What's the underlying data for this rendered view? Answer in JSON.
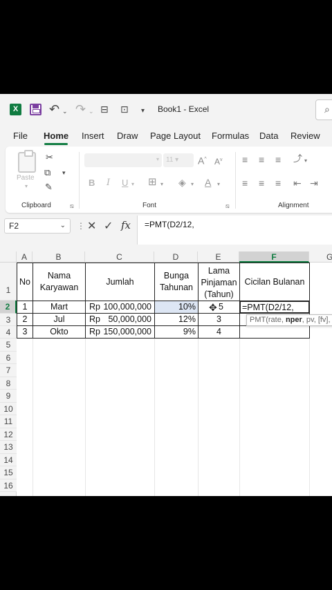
{
  "title_bar": {
    "window_title": "Book1  -  Excel",
    "logo_letter": "X"
  },
  "ribbon_tabs": [
    "File",
    "Home",
    "Insert",
    "Draw",
    "Page Layout",
    "Formulas",
    "Data",
    "Review"
  ],
  "active_tab": "Home",
  "ribbon": {
    "paste_label": "Paste",
    "font_size": "11",
    "groups": {
      "clipboard": "Clipboard",
      "font": "Font",
      "alignment": "Alignment"
    },
    "font_buttons": {
      "bold": "B",
      "italic": "I",
      "underline": "U"
    },
    "grow_font": "A",
    "shrink_font": "A"
  },
  "formula_bar": {
    "name_box": "F2",
    "formula": "=PMT(D2/12,"
  },
  "grid": {
    "columns": [
      "A",
      "B",
      "C",
      "D",
      "E",
      "F",
      "G"
    ],
    "rows": [
      "1",
      "2",
      "3",
      "4",
      "5",
      "6",
      "7",
      "8",
      "9",
      "10",
      "11",
      "12",
      "13",
      "14",
      "15",
      "16"
    ],
    "headers": {
      "no": "No",
      "nama": "Nama Karyawan",
      "jumlah": "Jumlah",
      "bunga": "Bunga Tahunan",
      "lama": "Lama Pinjaman (Tahun)",
      "cicilan": "Cicilan Bulanan"
    },
    "data_rows": [
      {
        "no": "1",
        "nama": "Mart",
        "currency": "Rp",
        "jumlah": "100,000,000",
        "bunga": "10%",
        "lama": "5",
        "cicilan": "=PMT(D2/12,"
      },
      {
        "no": "2",
        "nama": "Jul",
        "currency": "Rp",
        "jumlah": "50,000,000",
        "bunga": "12%",
        "lama": "3",
        "cicilan": ""
      },
      {
        "no": "3",
        "nama": "Okto",
        "currency": "Rp",
        "jumlah": "150,000,000",
        "bunga": "9%",
        "lama": "4",
        "cicilan": ""
      }
    ],
    "tooltip": {
      "prefix": "PMT(rate, ",
      "bold_arg": "nper",
      "suffix": ", pv, [fv], "
    }
  }
}
